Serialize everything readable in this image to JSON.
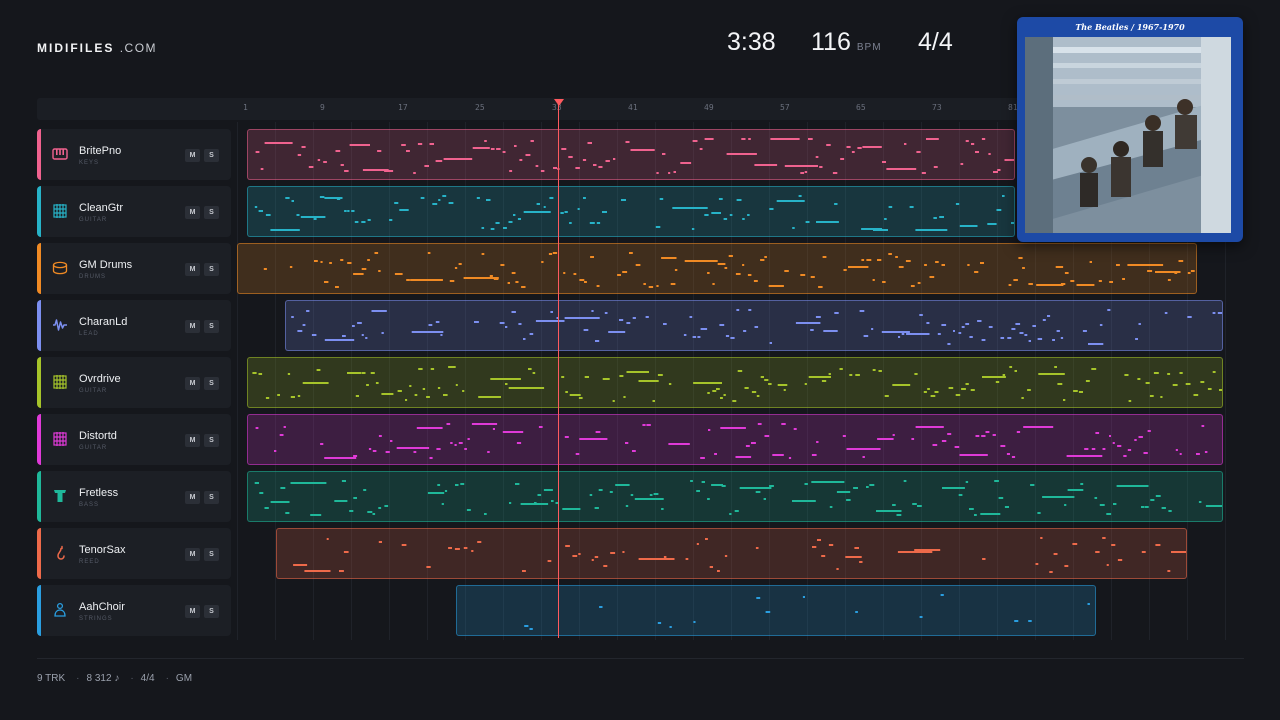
{
  "brand": {
    "name": "MIDIFILES",
    "domain": ".COM"
  },
  "transport": {
    "time": "3:38",
    "tempo": "116",
    "tempo_unit": "BPM",
    "signature": "4/4"
  },
  "ruler": {
    "ticks": [
      "1",
      "9",
      "17",
      "25",
      "33",
      "41",
      "49",
      "57",
      "65",
      "73",
      "81"
    ]
  },
  "mute_label": "M",
  "solo_label": "S",
  "tracks": [
    {
      "name": "BritePno",
      "category": "KEYS",
      "color": "#f0628f",
      "icon": "piano-icon"
    },
    {
      "name": "CleanGtr",
      "category": "GUITAR",
      "color": "#27b3c8",
      "icon": "guitar-grid-icon"
    },
    {
      "name": "GM Drums",
      "category": "DRUMS",
      "color": "#f08a24",
      "icon": "drum-icon"
    },
    {
      "name": "CharanLd",
      "category": "LEAD",
      "color": "#7c8ff0",
      "icon": "waveform-icon"
    },
    {
      "name": "Ovrdrive",
      "category": "GUITAR",
      "color": "#a6c42a",
      "icon": "guitar-grid-icon"
    },
    {
      "name": "Distortd",
      "category": "GUITAR",
      "color": "#e03ad8",
      "icon": "guitar-grid-icon"
    },
    {
      "name": "Fretless",
      "category": "BASS",
      "color": "#1fb89a",
      "icon": "bass-icon"
    },
    {
      "name": "TenorSax",
      "category": "REED",
      "color": "#ee6a4a",
      "icon": "sax-icon"
    },
    {
      "name": "AahChoir",
      "category": "STRINGS",
      "color": "#2a9ee0",
      "icon": "choir-icon"
    }
  ],
  "album": {
    "title": "The Beatles / 1967-1970",
    "bg_color": "#1d4aa6"
  },
  "footer": {
    "tracks": "9 TRK",
    "notes": "8 312 ♪",
    "signature": "4/4",
    "standard": "GM"
  }
}
